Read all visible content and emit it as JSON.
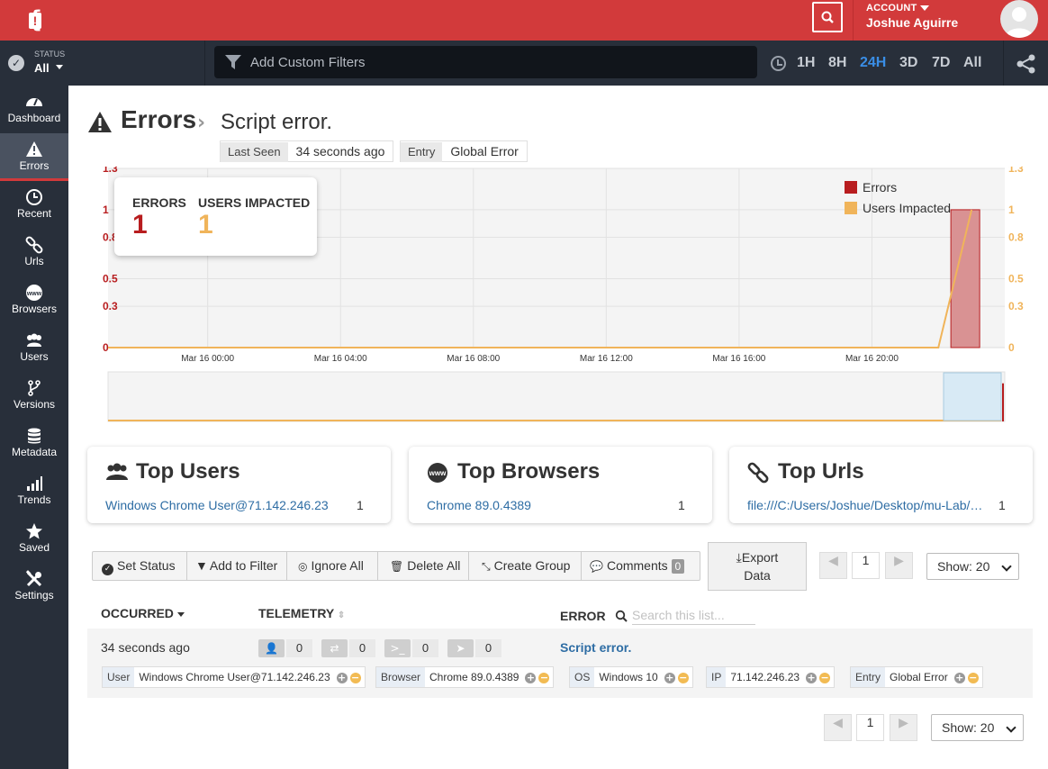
{
  "account": {
    "label": "ACCOUNT",
    "name": "Joshue Aguirre"
  },
  "status": {
    "label": "STATUS",
    "value": "All"
  },
  "filter": {
    "placeholder": "Add Custom Filters"
  },
  "ranges": [
    "1H",
    "8H",
    "24H",
    "3D",
    "7D",
    "All"
  ],
  "active_range": "24H",
  "nav": [
    {
      "label": "Dashboard",
      "icon": "gauge-icon"
    },
    {
      "label": "Errors",
      "icon": "warning-icon",
      "active": true
    },
    {
      "label": "Recent",
      "icon": "clock-icon"
    },
    {
      "label": "Urls",
      "icon": "link-icon"
    },
    {
      "label": "Browsers",
      "icon": "www-icon"
    },
    {
      "label": "Users",
      "icon": "users-icon"
    },
    {
      "label": "Versions",
      "icon": "branch-icon"
    },
    {
      "label": "Metadata",
      "icon": "database-icon"
    },
    {
      "label": "Trends",
      "icon": "trends-icon"
    },
    {
      "label": "Saved",
      "icon": "star-icon"
    },
    {
      "label": "Settings",
      "icon": "tools-icon"
    }
  ],
  "header": {
    "title": "Errors",
    "sep": "›",
    "subtitle": "Script error."
  },
  "pills": {
    "last_seen_label": "Last Seen",
    "last_seen_value": "34 seconds ago",
    "entry_label": "Entry",
    "entry_value": "Global Error"
  },
  "summary": {
    "errors_label": "ERRORS",
    "errors_value": "1",
    "users_label": "USERS IMPACTED",
    "users_value": "1"
  },
  "chart_data": {
    "type": "bar",
    "x_ticks": [
      "Mar 16 00:00",
      "Mar 16 04:00",
      "Mar 16 08:00",
      "Mar 16 12:00",
      "Mar 16 16:00",
      "Mar 16 20:00"
    ],
    "y_left_ticks": [
      "0",
      "0.3",
      "0.5",
      "0.8",
      "1",
      "1.3"
    ],
    "y_right_ticks": [
      "0",
      "0.3",
      "0.5",
      "0.8",
      "1",
      "1.3"
    ],
    "ylim": [
      0,
      1.3
    ],
    "series": [
      {
        "name": "Errors",
        "type": "bar",
        "color": "#b81d1f",
        "points": [
          {
            "x": "Mar 16 23:00",
            "y": 1
          }
        ]
      },
      {
        "name": "Users Impacted",
        "type": "line",
        "color": "#f0b45a",
        "points": [
          {
            "x": "Mar 15 21:00",
            "y": 0
          },
          {
            "x": "Mar 16 22:00",
            "y": 0
          },
          {
            "x": "Mar 16 23:00",
            "y": 1
          }
        ]
      }
    ],
    "legend": "top-right",
    "grid": true
  },
  "cards": [
    {
      "title": "Top Users",
      "icon": "users-icon",
      "link": "Windows Chrome User@71.142.246.23",
      "count": "1"
    },
    {
      "title": "Top Browsers",
      "icon": "www-icon",
      "link": "Chrome 89.0.4389",
      "count": "1"
    },
    {
      "title": "Top Urls",
      "icon": "link-icon",
      "link": "file:///C:/Users/Joshue/Desktop/mu-Lab/…",
      "count": "1"
    }
  ],
  "actions": {
    "set_status": "Set Status",
    "add_filter": "Add to Filter",
    "ignore_all": "Ignore All",
    "delete_all": "Delete All",
    "create_group": "Create Group",
    "comments": "Comments",
    "comments_count": "0",
    "export_line1": "Export",
    "export_line2": "Data"
  },
  "pagination": {
    "page": "1",
    "show": "Show: 20"
  },
  "table": {
    "col_occurred": "OCCURRED",
    "col_telemetry": "TELEMETRY",
    "col_error": "ERROR",
    "search_placeholder": "Search this list...",
    "row": {
      "time": "34 seconds ago",
      "telemetry": [
        {
          "icon": "user-icon",
          "count": "0"
        },
        {
          "icon": "network-icon",
          "count": "0"
        },
        {
          "icon": "console-icon",
          "count": "0"
        },
        {
          "icon": "navigation-icon",
          "count": "0"
        }
      ],
      "error": "Script error.",
      "tags": [
        {
          "key": "User",
          "value": "Windows Chrome User@71.142.246.23"
        },
        {
          "key": "Browser",
          "value": "Chrome 89.0.4389"
        },
        {
          "key": "OS",
          "value": "Windows 10"
        },
        {
          "key": "IP",
          "value": "71.142.246.23"
        },
        {
          "key": "Entry",
          "value": "Global Error"
        }
      ]
    }
  },
  "colors": {
    "brand": "#d23a3b",
    "sidebar": "#282f3a",
    "active": "#3a8ee6",
    "errors": "#b81d1f",
    "users": "#f0b45a",
    "link": "#2e6da4"
  }
}
